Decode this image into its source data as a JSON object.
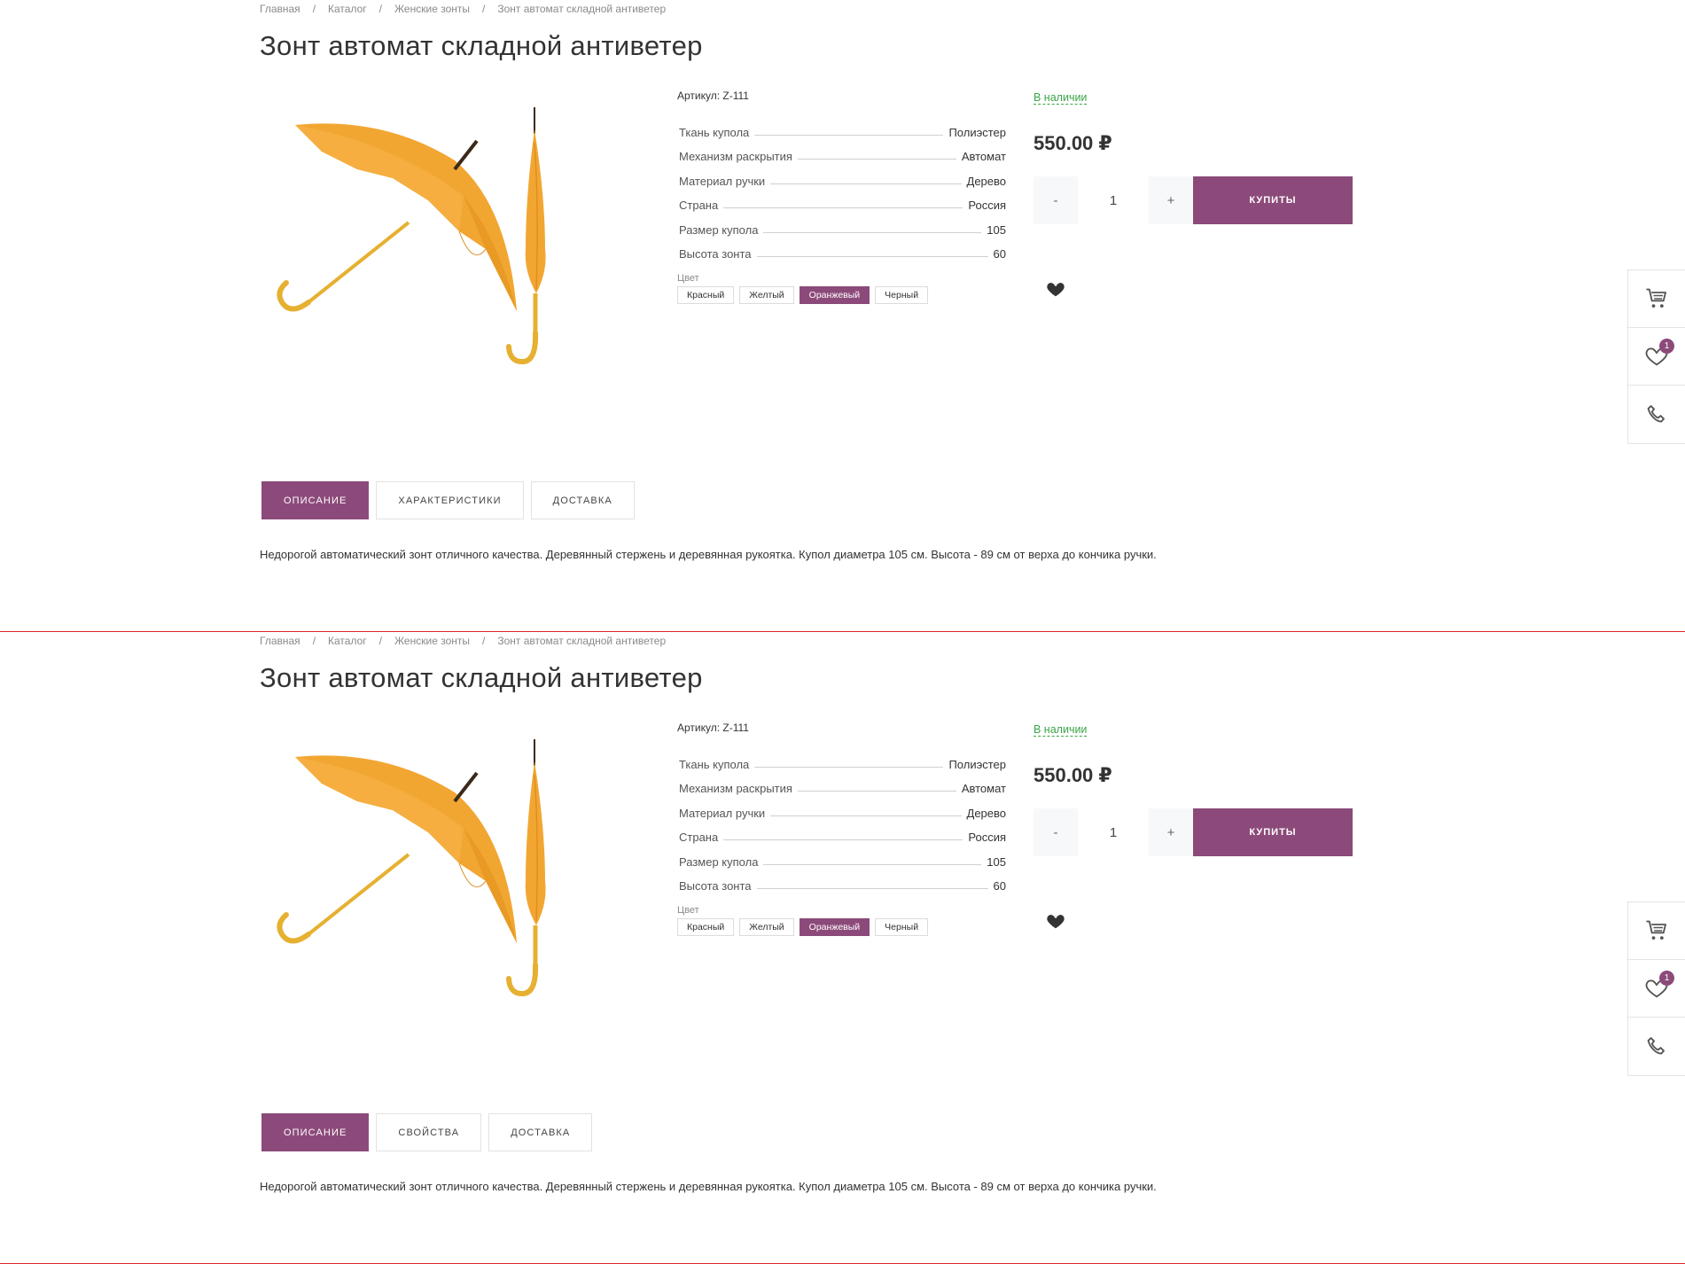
{
  "accent_color": "#8c4a7a",
  "stock_color": "#3aa54a",
  "sections": [
    {
      "breadcrumb": [
        "Главная",
        "Каталог",
        "Женские зонты",
        "Зонт автомат складной антиветер"
      ],
      "title": "Зонт автомат складной антиветер",
      "sku": "Артикул: Z-111",
      "props": [
        {
          "name": "Ткань купола",
          "value": "Полиэстер"
        },
        {
          "name": "Механизм раскрытия",
          "value": "Автомат"
        },
        {
          "name": "Материал ручки",
          "value": "Дерево"
        },
        {
          "name": "Страна",
          "value": "Россия"
        },
        {
          "name": "Размер купола",
          "value": "105"
        },
        {
          "name": "Высота зонта",
          "value": "60"
        }
      ],
      "color_label": "Цвет",
      "colors": [
        "Красный",
        "Желтый",
        "Оранжевый",
        "Черный"
      ],
      "selected_color": "Оранжевый",
      "stock": "В наличии",
      "price": "550.00 ₽",
      "qty_minus": "-",
      "qty": "1",
      "qty_plus": "+",
      "buy_label": "купиты",
      "tabs": [
        "Описание",
        "Характеристики",
        "Доставка"
      ],
      "active_tab": "Описание",
      "description": "Недорогой автоматический зонт отличного качества. Деревянный стержень и деревянная рукоятка. Купол диаметра 105 см. Высота - 89 см от верха до кончика ручки.",
      "wishlist_count": "1",
      "icons": {
        "wish": "heart-icon",
        "cart": "cart-icon",
        "favorites": "heart-outline-icon",
        "phone": "phone-icon"
      }
    },
    {
      "breadcrumb": [
        "Главная",
        "Каталог",
        "Женские зонты",
        "Зонт автомат складной антиветер"
      ],
      "title": "Зонт автомат складной антиветер",
      "sku": "Артикул: Z-111",
      "props": [
        {
          "name": "Ткань купола",
          "value": "Полиэстер"
        },
        {
          "name": "Механизм раскрытия",
          "value": "Автомат"
        },
        {
          "name": "Материал ручки",
          "value": "Дерево"
        },
        {
          "name": "Страна",
          "value": "Россия"
        },
        {
          "name": "Размер купола",
          "value": "105"
        },
        {
          "name": "Высота зонта",
          "value": "60"
        }
      ],
      "color_label": "Цвет",
      "colors": [
        "Красный",
        "Желтый",
        "Оранжевый",
        "Черный"
      ],
      "selected_color": "Оранжевый",
      "stock": "В наличии",
      "price": "550.00 ₽",
      "qty_minus": "-",
      "qty": "1",
      "qty_plus": "+",
      "buy_label": "купиты",
      "tabs": [
        "Описание",
        "Свойства",
        "Доставка"
      ],
      "active_tab": "Описание",
      "description": "Недорогой автоматический зонт отличного качества. Деревянный стержень и деревянная рукоятка. Купол диаметра 105 см. Высота - 89 см от верха до кончика ручки.",
      "wishlist_count": "1",
      "icons": {
        "wish": "heart-icon",
        "cart": "cart-icon",
        "favorites": "heart-outline-icon",
        "phone": "phone-icon"
      }
    }
  ]
}
